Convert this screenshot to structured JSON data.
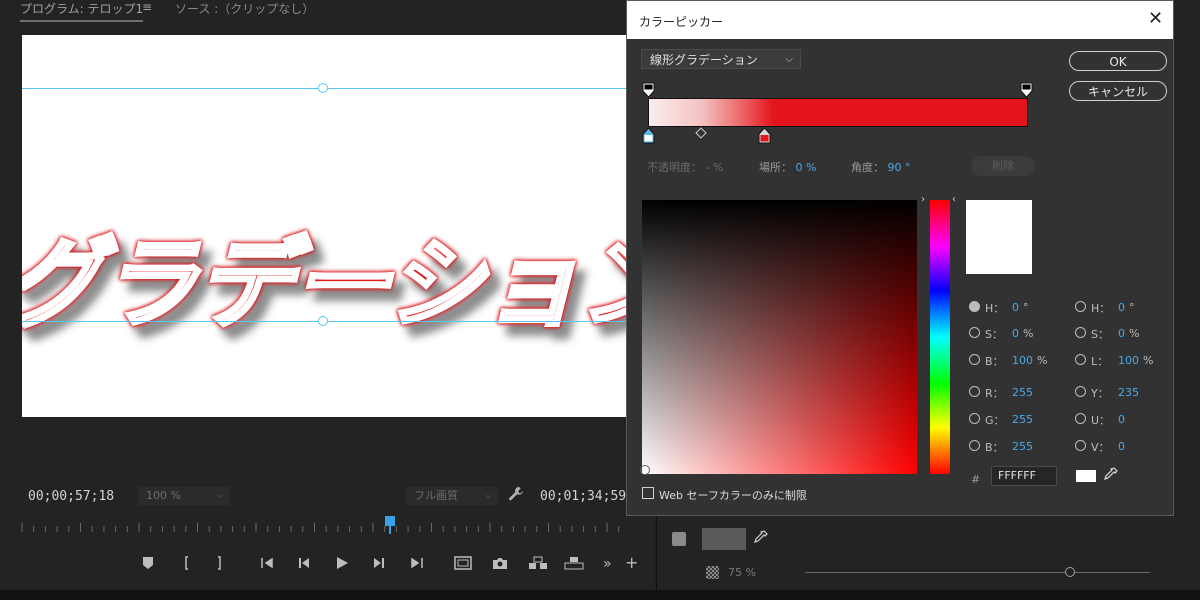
{
  "program_monitor": {
    "tab_program": "プログラム: テロップ1",
    "tab_source": "ソース :（クリップなし）",
    "title_text": "グラデーション",
    "timecode_current": "00;00;57;18",
    "timecode_duration": "00;01;34;59",
    "zoom_value": "100 %",
    "quality_value": "フル画質",
    "menu_icon": "≡"
  },
  "background_panel": {
    "opacity_value": "75 %"
  },
  "color_picker": {
    "title": "カラーピッカー",
    "gradient_type": "線形グラデーション",
    "ok_label": "OK",
    "cancel_label": "キャンセル",
    "opacity_label": "不透明度：",
    "opacity_value": "- %",
    "location_label": "場所：",
    "location_value": "0 %",
    "angle_label": "角度：",
    "angle_value": "90 °",
    "delete_label": "削除",
    "hex_hash": "#",
    "hex_value": "FFFFFF",
    "websafe_label": "Web セーフカラーのみに制限",
    "gradient_colors": {
      "start": "#FFFFFF",
      "end": "#E3141B"
    },
    "left_fields": [
      {
        "label": "H：",
        "value": "0",
        "unit": "°",
        "selected": true
      },
      {
        "label": "S：",
        "value": "0",
        "unit": "%",
        "selected": false
      },
      {
        "label": "B：",
        "value": "100",
        "unit": "%",
        "selected": false
      },
      {
        "label": "R：",
        "value": "255",
        "unit": "",
        "selected": false
      },
      {
        "label": "G：",
        "value": "255",
        "unit": "",
        "selected": false
      },
      {
        "label": "B：",
        "value": "255",
        "unit": "",
        "selected": false
      }
    ],
    "right_fields": [
      {
        "label": "H：",
        "value": "0",
        "unit": "°"
      },
      {
        "label": "S：",
        "value": "0",
        "unit": "%"
      },
      {
        "label": "L：",
        "value": "100",
        "unit": "%"
      },
      {
        "label": "Y：",
        "value": "235",
        "unit": ""
      },
      {
        "label": "U：",
        "value": "0",
        "unit": ""
      },
      {
        "label": "V：",
        "value": "0",
        "unit": ""
      }
    ]
  }
}
